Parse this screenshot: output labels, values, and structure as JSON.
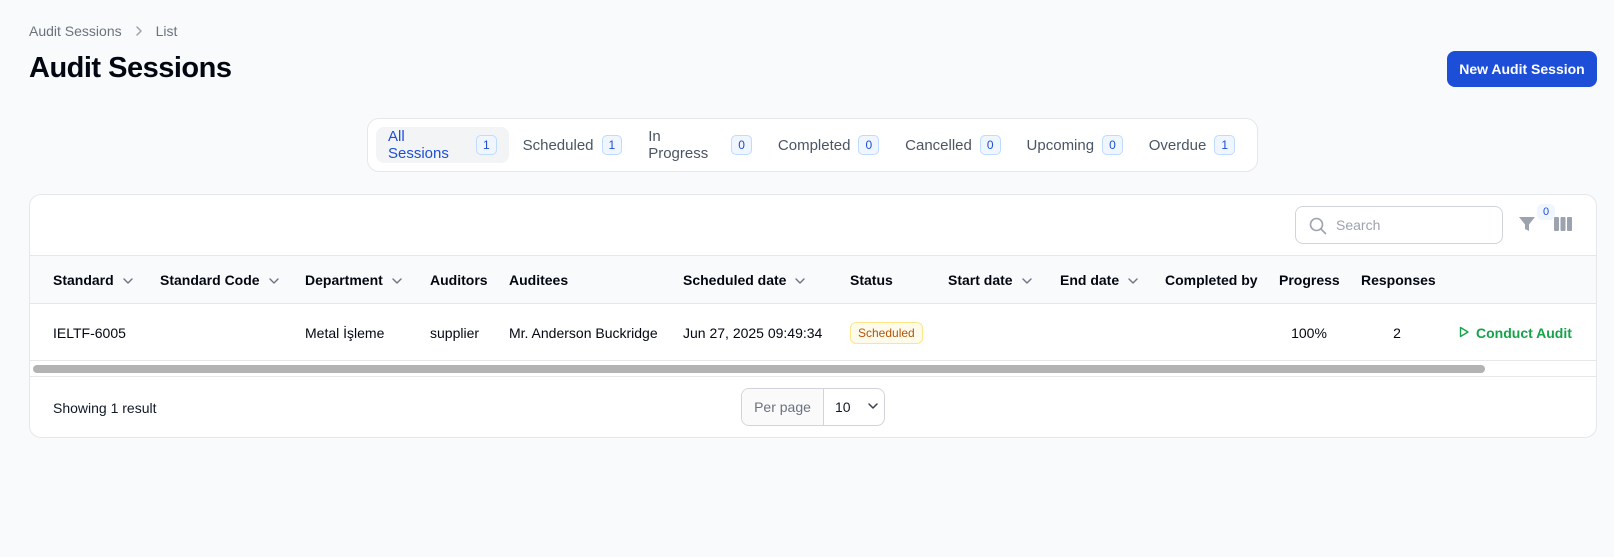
{
  "breadcrumb": {
    "items": [
      "Audit Sessions",
      "List"
    ]
  },
  "page": {
    "title": "Audit Sessions",
    "new_button": "New Audit Session"
  },
  "tabs": [
    {
      "label": "All Sessions",
      "count": "1",
      "active": true
    },
    {
      "label": "Scheduled",
      "count": "1"
    },
    {
      "label": "In Progress",
      "count": "0"
    },
    {
      "label": "Completed",
      "count": "0"
    },
    {
      "label": "Cancelled",
      "count": "0"
    },
    {
      "label": "Upcoming",
      "count": "0"
    },
    {
      "label": "Overdue",
      "count": "1"
    }
  ],
  "toolbar": {
    "search_placeholder": "Search",
    "filter_count": "0"
  },
  "table": {
    "columns": [
      "Standard",
      "Standard Code",
      "Department",
      "Auditors",
      "Auditees",
      "Scheduled date",
      "Status",
      "Start date",
      "End date",
      "Completed by",
      "Progress",
      "Responses"
    ],
    "rows": [
      {
        "standard": "IELTF-6005",
        "standard_code": "",
        "department": "Metal İşleme",
        "auditors": "supplier",
        "auditees": "Mr. Anderson Buckridge",
        "scheduled_date": "Jun 27, 2025 09:49:34",
        "status": "Scheduled",
        "start_date": "",
        "end_date": "",
        "completed_by": "",
        "progress": "100%",
        "responses": "2",
        "action": "Conduct Audit"
      }
    ]
  },
  "footer": {
    "showing": "Showing 1 result",
    "per_page_label": "Per page",
    "per_page_value": "10"
  },
  "colors": {
    "primary": "#1d4ed8",
    "status_scheduled": "#b45309",
    "conduct": "#16a34a"
  }
}
